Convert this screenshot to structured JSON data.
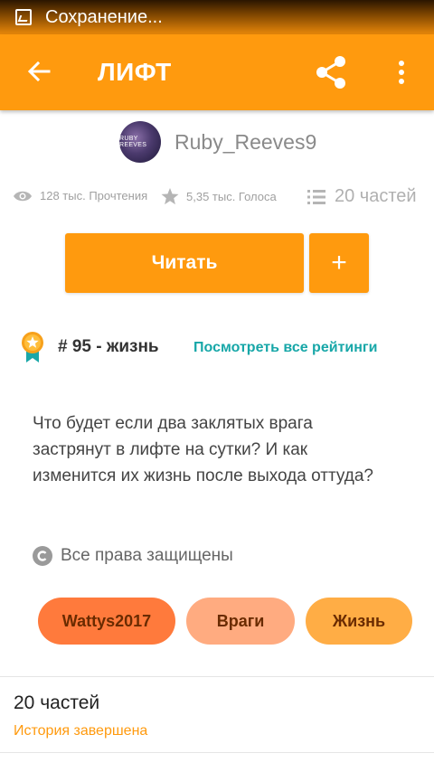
{
  "status_bar": {
    "text": "Сохранение..."
  },
  "toolbar": {
    "title": "ЛИФТ"
  },
  "author": {
    "name": "Ruby_Reeves9",
    "avatar_text": "RUBY REEVES"
  },
  "stats": {
    "reads": "128 тыс. Прочтения",
    "votes": "5,35 тыс. Голоса",
    "parts": "20 частей"
  },
  "actions": {
    "read_label": "Читать",
    "add_label": "+"
  },
  "ranking": {
    "text": "# 95 - жизнь",
    "link": "Посмотреть все рейтинги"
  },
  "description": "Что будет если два заклятых врага застрянут в лифте на сутки? И как изменится их жизнь после выхода оттуда?",
  "copyright": {
    "text": "Все права защищены"
  },
  "tags": [
    {
      "label": "Wattys2017",
      "color": "#ff7a3c"
    },
    {
      "label": "Враги",
      "color": "#ffab80"
    },
    {
      "label": "Жизнь",
      "color": "#ffad45"
    }
  ],
  "parts_section": {
    "title": "20 частей",
    "status": "История завершена"
  },
  "colors": {
    "accent": "#ff9a0e",
    "link": "#17a7a8"
  }
}
